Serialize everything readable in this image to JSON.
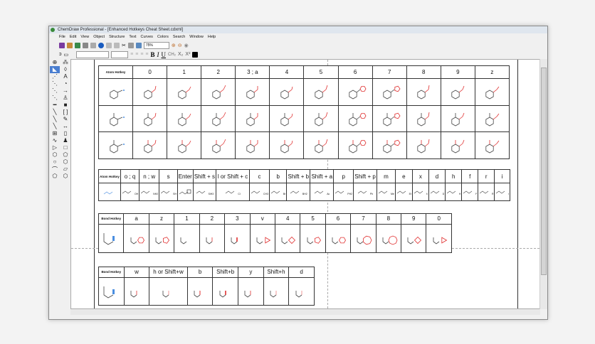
{
  "window": {
    "title": "ChemDraw Professional - [Enhanced Hotkeys Cheat Sheet.cdxml]"
  },
  "menu": [
    "File",
    "Edit",
    "View",
    "Object",
    "Structure",
    "Text",
    "Curves",
    "Colors",
    "Search",
    "Window",
    "Help"
  ],
  "toolbar": {
    "zoom": "75%",
    "bold": "B",
    "italic": "I",
    "underline": "U",
    "chem": "CH₂",
    "subscript": "X₂",
    "superscript": "X²"
  },
  "accent": {
    "red": "#e03030",
    "blue": "#4a8ee0"
  },
  "table1": {
    "label": "Atom Hotkey",
    "keys": [
      "0",
      "1",
      "2",
      "3 ; a",
      "4",
      "5",
      "6",
      "7",
      "8",
      "9",
      "z"
    ]
  },
  "table2": {
    "label": "Atom Hotkey",
    "keys": [
      "o ; q",
      "n ; w",
      "s",
      "Enter",
      "Shift + s",
      "l or Shift + c",
      "c",
      "b",
      "Shift + b",
      "Shift + a",
      "p",
      "Shift + p",
      "m",
      "e",
      "x",
      "d",
      "h",
      "f",
      "r",
      "i"
    ],
    "labels": [
      "OH",
      "NH2",
      "SH",
      "",
      "SiH3",
      "Cl",
      "CH3",
      "Br",
      "BH2",
      "Ac",
      "PH2",
      "Ph",
      "Me",
      "Et",
      "X",
      "D",
      "H",
      "F",
      "R",
      "I"
    ]
  },
  "table3": {
    "label": "Bond Hotkey",
    "keys": [
      "a",
      "z",
      "1",
      "2",
      "3",
      "v",
      "4",
      "5",
      "6",
      "7",
      "8",
      "9",
      "0"
    ]
  },
  "table4": {
    "label": "Bond Hotkey",
    "keys": [
      "w",
      "h or Shift+w",
      "b",
      "Shift+b",
      "y",
      "Shift+h",
      "d"
    ]
  }
}
